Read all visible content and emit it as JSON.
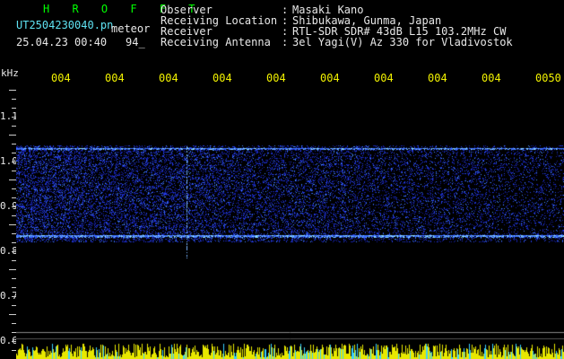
{
  "header": {
    "program": "H R O F F T",
    "filename": "UT2504230040.pn",
    "tag": "meteor",
    "datetime": "25.04.23 00:40",
    "count": "94_",
    "fields": [
      {
        "label": "Observer",
        "sep": ":",
        "value": "Masaki Kano"
      },
      {
        "label": "Receiving Location",
        "sep": ":",
        "value": "Shibukawa, Gunma, Japan"
      },
      {
        "label": "Receiver",
        "sep": ":",
        "value": "RTL-SDR SDR# 43dB L15 103.2MHz CW"
      },
      {
        "label": "Receiving Antenna",
        "sep": ":",
        "value": "3el Yagi(V) Az 330 for Vladivostok"
      }
    ]
  },
  "axis": {
    "unit": "kHz",
    "y_labels": [
      "1.1",
      "1.0",
      "0.9",
      "0.8",
      "0.7",
      "0.6"
    ],
    "time_labels": [
      "004",
      "004",
      "004",
      "004",
      "004",
      "004",
      "004",
      "004",
      "004",
      "0050"
    ]
  },
  "colors": {
    "background": "#000000",
    "program": "#00ff00",
    "filename": "#5fe3f3",
    "labels": "#e8e8e8",
    "time_labels": "#f2f200",
    "signal": "#2b4cff",
    "signal_bright": "#60c8ff",
    "amplitude": "#e8e800"
  }
}
